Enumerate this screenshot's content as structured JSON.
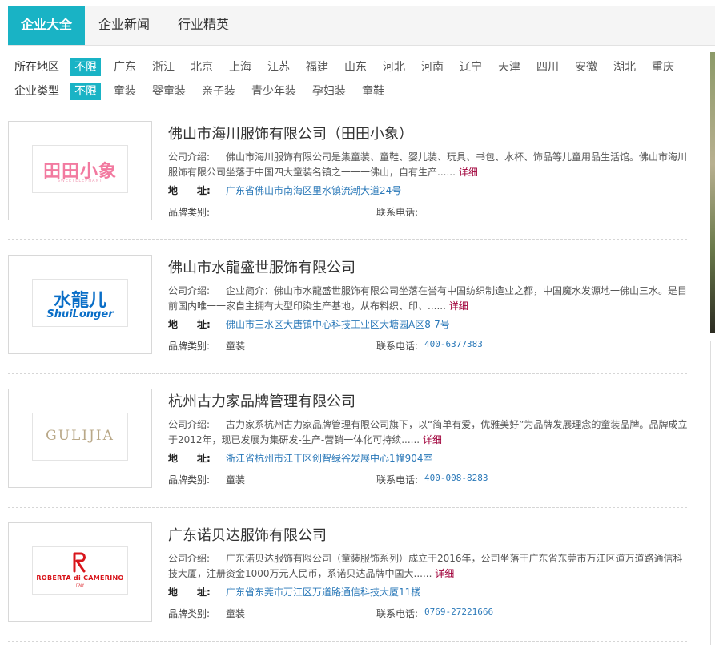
{
  "tabs": [
    {
      "label": "企业大全",
      "active": true
    },
    {
      "label": "企业新闻",
      "active": false
    },
    {
      "label": "行业精英",
      "active": false
    }
  ],
  "filters": {
    "region": {
      "label": "所在地区",
      "options": [
        "不限",
        "广东",
        "浙江",
        "北京",
        "上海",
        "江苏",
        "福建",
        "山东",
        "河北",
        "河南",
        "辽宁",
        "天津",
        "四川",
        "安徽",
        "湖北",
        "重庆"
      ]
    },
    "type": {
      "label": "企业类型",
      "options": [
        "不限",
        "童装",
        "婴童装",
        "亲子装",
        "青少年装",
        "孕妇装",
        "童鞋"
      ]
    }
  },
  "labels": {
    "intro": "公司介绍:",
    "address": "地　　址:",
    "brand": "品牌类别:",
    "phone": "联系电话:",
    "detail": "详细",
    "ellipsis": "......"
  },
  "companies": [
    {
      "name": "佛山市海川服饰有限公司（田田小象）",
      "logo_text": "田田小象",
      "logo_sub": "SWEETELEPHANT",
      "intro": "佛山市海川服饰有限公司是集童装、童鞋、婴儿装、玩具、书包、水杯、饰品等儿童用品生活馆。佛山市海川服饰有限公司坐落于中国四大童装名镇之一一一佛山，自有生产",
      "address": "广东省佛山市南海区里水镇流潮大道24号",
      "brand": "",
      "phone": ""
    },
    {
      "name": "佛山市水龍盛世服饰有限公司",
      "logo_text": "水龍儿",
      "logo_sub": "ShuiLonger",
      "intro": "企业简介：佛山市水龍盛世服饰有限公司坐落在誉有中国纺织制造业之都，中国魔水发源地一佛山三水。是目前国内唯一一家自主拥有大型印染生产基地，从布料织、印、",
      "address": "佛山市三水区大唐镇中心科技工业区大塘园A区8-7号",
      "brand": "童装",
      "phone": "400-6377383"
    },
    {
      "name": "杭州古力家品牌管理有限公司",
      "logo_text": "GULIJIA",
      "logo_sub": "",
      "intro": "古力家系杭州古力家品牌管理有限公司旗下，以“简单有爱，优雅美好”为品牌发展理念的童装品牌。品牌成立于2012年，现已发展为集研发-生产-营销一体化可持续",
      "address": "浙江省杭州市江干区创智绿谷发展中心1幢904室",
      "brand": "童装",
      "phone": "400-008-8283"
    },
    {
      "name": "广东诺贝达服饰有限公司",
      "logo_text": "ROBERTA di CAMERINO",
      "logo_sub": "ITALY",
      "intro": "广东诺贝达服饰有限公司（童装服饰系列）成立于2016年，公司坐落于广东省东莞市万江区道万道路通信科技大厦，注册资金1000万元人民币，系诺贝达品牌中国大",
      "address": "广东省东莞市万江区万道路通信科技大厦11楼",
      "brand": "童装",
      "phone": "0769-27221666"
    }
  ]
}
